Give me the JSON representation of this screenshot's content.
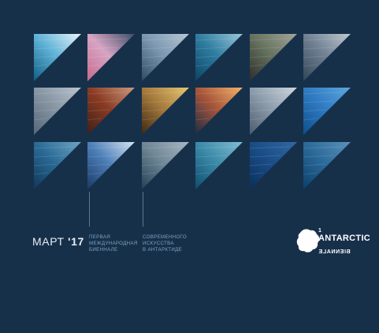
{
  "header_date": {
    "month": "МАРТ",
    "year": "'17"
  },
  "captions": [
    [
      "ПЕРВАЯ",
      "МЕЖДУНАРОДНАЯ",
      "БИЕННАЛЕ"
    ],
    [
      "СОВРЕМЕННОГО",
      "ИСКУССТВА",
      "В АНТАРКТИДЕ"
    ]
  ],
  "logo": {
    "number": "1",
    "name": "ANTARCTIC",
    "subtitle": "BIENNALE"
  },
  "colors": {
    "background": "#17304a",
    "accent_line": "#5f87a6",
    "caption_text": "#7fa2c1",
    "date_text": "#e7edf3"
  },
  "tiles": [
    {
      "name": "glacier-ice",
      "colors": [
        "#0f5d86",
        "#5fb2d6",
        "#e9f4fb"
      ]
    },
    {
      "name": "pink-sky-iceberg",
      "colors": [
        "#c66a8c",
        "#d7a4c4",
        "#3b5068"
      ]
    },
    {
      "name": "ice-cliff",
      "colors": [
        "#2e4a63",
        "#7b97b0",
        "#b7c7d4"
      ]
    },
    {
      "name": "calm-sea",
      "colors": [
        "#0b4466",
        "#2f7da0",
        "#9ac6d9"
      ]
    },
    {
      "name": "rocky-coast",
      "colors": [
        "#2c2d2c",
        "#66725e",
        "#a3a59a"
      ]
    },
    {
      "name": "misty-ice",
      "colors": [
        "#314456",
        "#6f8092",
        "#c0c9d1"
      ]
    },
    {
      "name": "ship-mast",
      "colors": [
        "#556677",
        "#8795a3",
        "#b9c4ce"
      ]
    },
    {
      "name": "rust-rocks",
      "colors": [
        "#3f1f18",
        "#8a3b22",
        "#c99a80"
      ]
    },
    {
      "name": "penguin-colony",
      "colors": [
        "#3d2712",
        "#a57a3c",
        "#e7c873"
      ]
    },
    {
      "name": "sunset-water",
      "colors": [
        "#1b2d45",
        "#a8553a",
        "#f2b26a"
      ]
    },
    {
      "name": "floating-ice",
      "colors": [
        "#4b5c6d",
        "#8c9cab",
        "#cfd7de"
      ]
    },
    {
      "name": "blue-ice-wave",
      "colors": [
        "#0d4f8c",
        "#2f7bc2",
        "#5fa6de"
      ]
    },
    {
      "name": "ocean-ripples",
      "colors": [
        "#103859",
        "#2a6a95",
        "#6ea5c6"
      ]
    },
    {
      "name": "ice-cave",
      "colors": [
        "#1a3a66",
        "#4d7fb8",
        "#d6e4f2"
      ]
    },
    {
      "name": "textured-ice",
      "colors": [
        "#234155",
        "#6f8796",
        "#a9b8c2"
      ]
    },
    {
      "name": "bubble-ice",
      "colors": [
        "#0f4d6e",
        "#3b8aa8",
        "#83bdd2"
      ]
    },
    {
      "name": "deep-blue",
      "colors": [
        "#0a2f5c",
        "#1a4d86",
        "#2f69a3"
      ]
    },
    {
      "name": "underwater",
      "colors": [
        "#0c3f6b",
        "#2b6a99",
        "#5b92bd"
      ]
    }
  ]
}
